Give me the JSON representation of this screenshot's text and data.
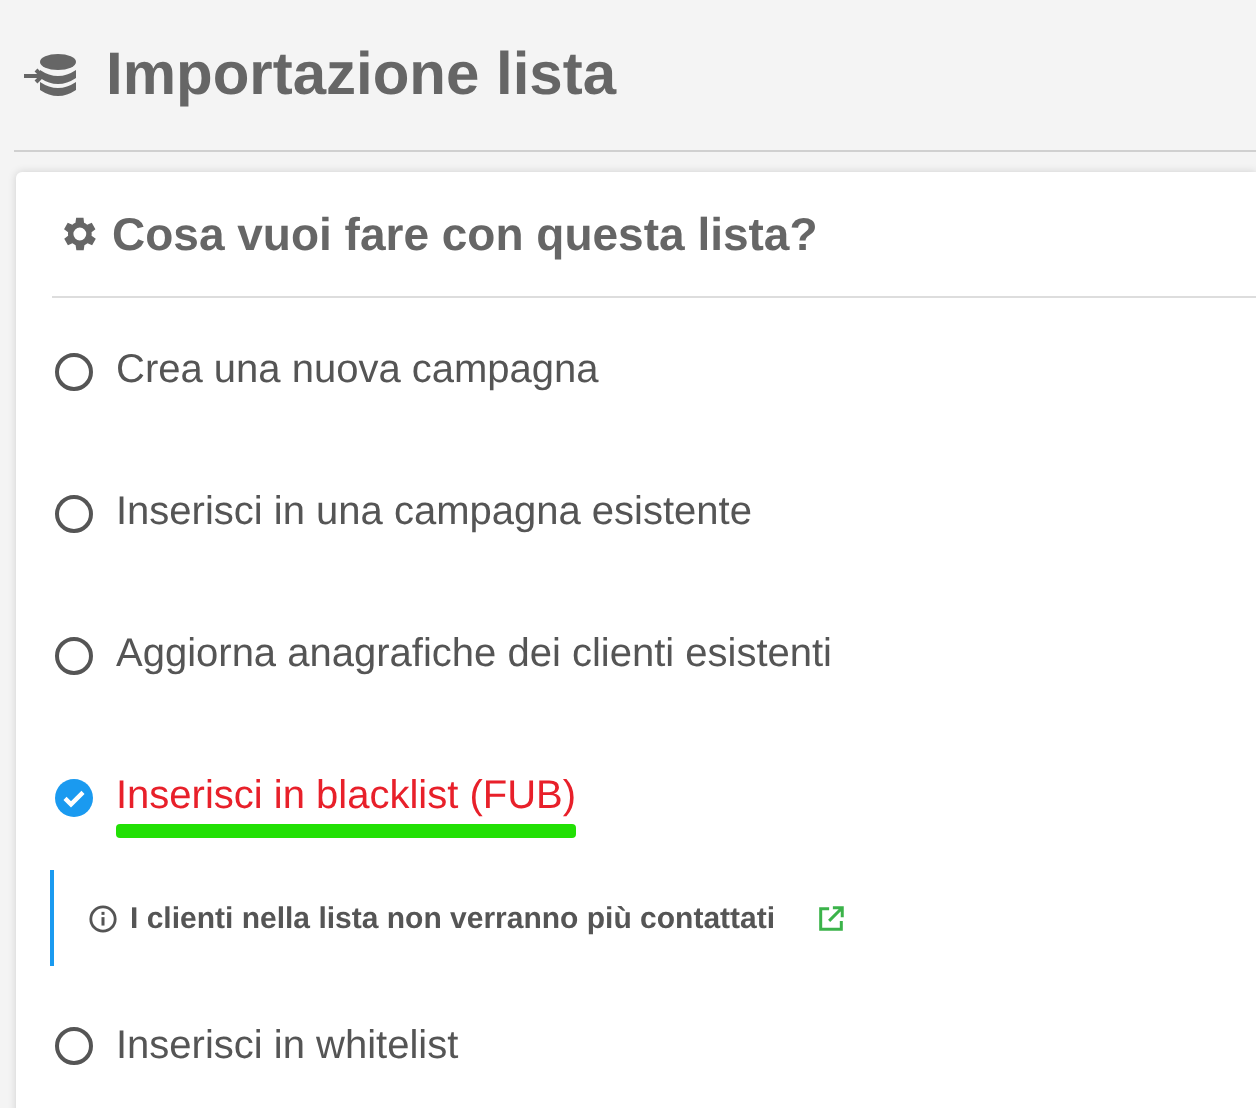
{
  "page": {
    "title": "Importazione lista"
  },
  "card": {
    "title": "Cosa vuoi fare con questa lista?",
    "options": [
      {
        "label": "Crea una nuova campagna",
        "selected": false,
        "highlighted": false
      },
      {
        "label": "Inserisci in una campagna esistente",
        "selected": false,
        "highlighted": false
      },
      {
        "label": "Aggiorna anagrafiche dei clienti esistenti",
        "selected": false,
        "highlighted": false
      },
      {
        "label": "Inserisci in blacklist (FUB)",
        "selected": true,
        "highlighted": true,
        "note": {
          "text": "I clienti nella lista non verranno più contattati"
        }
      },
      {
        "label": "Inserisci in whitelist",
        "selected": false,
        "highlighted": false
      }
    ]
  }
}
